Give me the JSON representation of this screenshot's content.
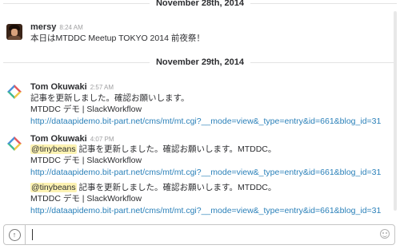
{
  "divider_1": {
    "label": "November 28th, 2014"
  },
  "divider_2": {
    "label": "November 29th, 2014"
  },
  "messages": [
    {
      "author": "mersy",
      "time": "8:24 AM",
      "avatar_icon": "user-photo",
      "lines": [
        "本日はMTDDC Meetup TOKYO 2014 前夜祭！"
      ]
    },
    {
      "author": "Tom Okuwaki",
      "time": "2:57 AM",
      "avatar_icon": "app-logo",
      "lines": [
        "記事を更新しました。確認お願いします。",
        "MTDDC デモ | SlackWorkflow",
        "http://dataapidemo.bit-part.net/cms/mt/mt.cgi?__mode=view&_type=entry&id=661&blog_id=31"
      ]
    },
    {
      "author": "Tom Okuwaki",
      "time": "4:07 PM",
      "avatar_icon": "app-logo",
      "mention": "@tinybeans",
      "lines": [
        " 記事を更新しました。確認お願いします。MTDDC。",
        "MTDDC デモ | SlackWorkflow",
        "http://dataapidemo.bit-part.net/cms/mt/mt.cgi?__mode=view&_type=entry&id=661&blog_id=31"
      ],
      "repeat_mention": "@tinybeans",
      "repeat_lines": [
        " 記事を更新しました。確認お願いします。MTDDC。",
        "MTDDC デモ | SlackWorkflow",
        "http://dataapidemo.bit-part.net/cms/mt/mt.cgi?__mode=view&_type=entry&id=661&blog_id=31"
      ]
    }
  ],
  "composer": {
    "upload_icon": "upload-arrow-icon",
    "upload_glyph": "↑",
    "emoji_icon": "smiley-icon",
    "value": ""
  },
  "colors": {
    "link": "#2a80b9",
    "mention_bg": "#fdf3b3",
    "logo_red": "#e5575a",
    "logo_yellow": "#f2c744",
    "logo_blue": "#4a90d9",
    "logo_green": "#3eb991"
  }
}
